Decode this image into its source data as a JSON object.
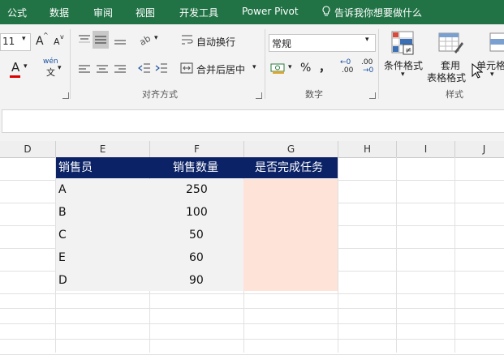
{
  "tabs": {
    "items": [
      "公式",
      "数据",
      "审阅",
      "视图",
      "开发工具",
      "Power Pivot"
    ],
    "tell_me": "告诉我你想要做什么"
  },
  "ribbon": {
    "font_size": "11",
    "grow_font": "A",
    "shrink_font": "A",
    "font_color_label": "A",
    "phonetic_top": "wén",
    "phonetic_bottom": "文",
    "wrap_text": "自动换行",
    "merge_center": "合并后居中",
    "alignment_group": "对齐方式",
    "number_format": "常规",
    "percent": "%",
    "comma": "，",
    "inc_decimal": ".00",
    "dec_decimal": ".00",
    "number_group": "数字",
    "conditional_format": "条件格式",
    "format_table_line1": "套用",
    "format_table_line2": "表格格式",
    "cell_styles": "单元格",
    "styles_group": "样式"
  },
  "columns": [
    "D",
    "E",
    "F",
    "G",
    "H",
    "I",
    "J"
  ],
  "table": {
    "headers": [
      "销售员",
      "销售数量",
      "是否完成任务"
    ],
    "rows": [
      {
        "name": "A",
        "qty": "250"
      },
      {
        "name": "B",
        "qty": "100"
      },
      {
        "name": "C",
        "qty": "50"
      },
      {
        "name": "E",
        "qty": "60"
      },
      {
        "name": "D",
        "qty": "90"
      }
    ]
  },
  "colors": {
    "tab_bar": "#217346",
    "table_header": "#0b2266",
    "name_fill": "#f2f2f2",
    "result_fill": "#fde3d8"
  }
}
